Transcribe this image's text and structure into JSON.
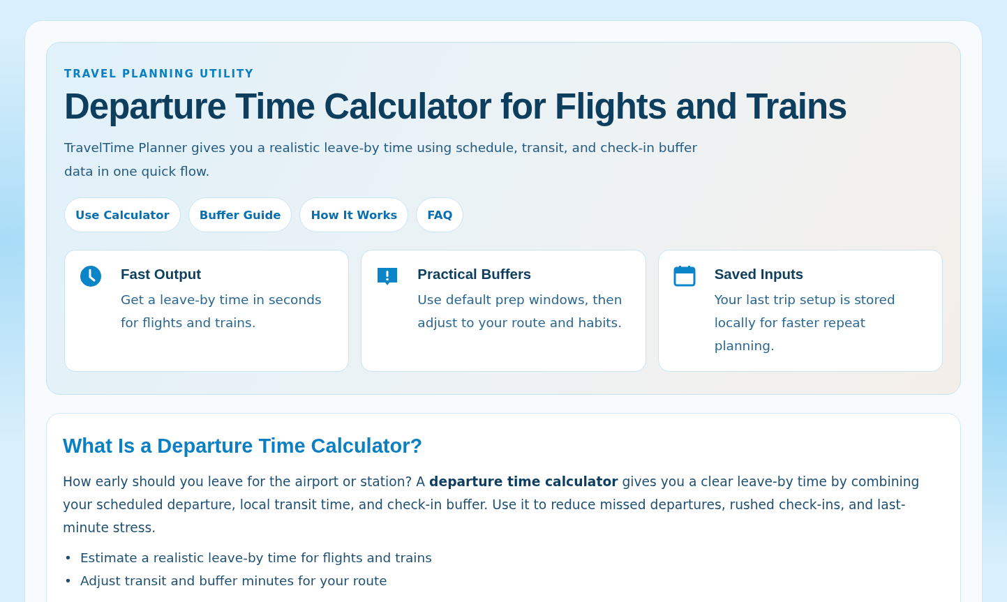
{
  "hero": {
    "eyebrow": "TRAVEL PLANNING UTILITY",
    "title": "Departure Time Calculator for Flights and Trains",
    "intro": "TravelTime Planner gives you a realistic leave-by time using schedule, transit, and check-in buffer data in one quick flow.",
    "links": [
      "Use Calculator",
      "Buffer Guide",
      "How It Works",
      "FAQ"
    ],
    "features": [
      {
        "kind": "clock",
        "title": "Fast Output",
        "text": "Get a leave-by time in seconds for flights and trains."
      },
      {
        "kind": "alert",
        "title": "Practical Buffers",
        "text": "Use default prep windows, then adjust to your route and habits."
      },
      {
        "kind": "calendar",
        "title": "Saved Inputs",
        "text": "Your last trip setup is stored locally for faster repeat planning."
      }
    ]
  },
  "about": {
    "heading": "What Is a Departure Time Calculator?",
    "paragraph": "How early should you leave for the airport or station? A **departure time calculator** gives you a clear leave-by time by combining your scheduled departure, local transit time, and check-in buffer. Use it to reduce missed departures, rushed check-ins, and last-minute stress.",
    "bullets": [
      {
        "marker": "•",
        "text": "Estimate a realistic leave-by time for flights and trains"
      },
      {
        "marker": "•",
        "text": "Adjust transit and buffer minutes for your route"
      }
    ]
  }
}
